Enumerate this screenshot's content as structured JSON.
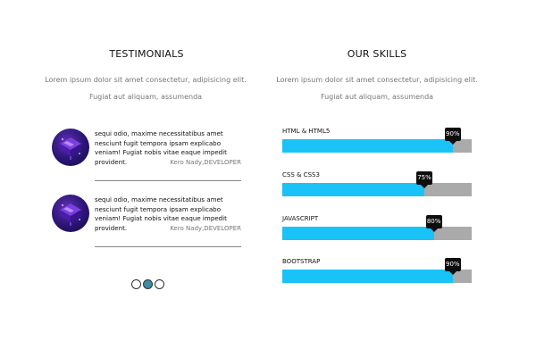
{
  "testimonials": {
    "title": "TESTIMONIALS",
    "subtitle": "Lorem ipsum dolor sit amet consectetur, adipisicing elit. Fugiat aut aliquam, assumenda",
    "items": [
      {
        "quote": "sequi odio, maxime necessitatibus amet nesciunt fugit tempora ipsam explicabo veniam! Fugiat nobis vitae eaque impedit provident.",
        "author": "Kero Nady,DEVELOPER",
        "avatar_icon": "isometric-tech-illustration-icon"
      },
      {
        "quote": "sequi odio, maxime necessitatibus amet nesciunt fugit tempora ipsam explicabo veniam! Fugiat nobis vitae eaque impedit provident.",
        "author": "Kero Nady,DEVELOPER",
        "avatar_icon": "isometric-tech-illustration-icon"
      }
    ],
    "pagination": {
      "count": 3,
      "active_index": 1
    }
  },
  "skills": {
    "title": "OUR SKILLS",
    "subtitle": "Lorem ipsum dolor sit amet consectetur, adipisicing elit. Fugiat aut aliquam, assumenda",
    "items": [
      {
        "name": "HTML & HTML5",
        "percent": 90,
        "label": "90%"
      },
      {
        "name": "CSS & CSS3",
        "percent": 75,
        "label": "75%"
      },
      {
        "name": "JAVASCRIPT",
        "percent": 80,
        "label": "80%"
      },
      {
        "name": "BOOTSTRAP",
        "percent": 90,
        "label": "90%"
      }
    ]
  },
  "colors": {
    "bar_fill": "#19c3f7",
    "bar_track": "#aaaaaa",
    "bubble": "#0e0e0e",
    "active_dot": "#3b8ea5"
  }
}
